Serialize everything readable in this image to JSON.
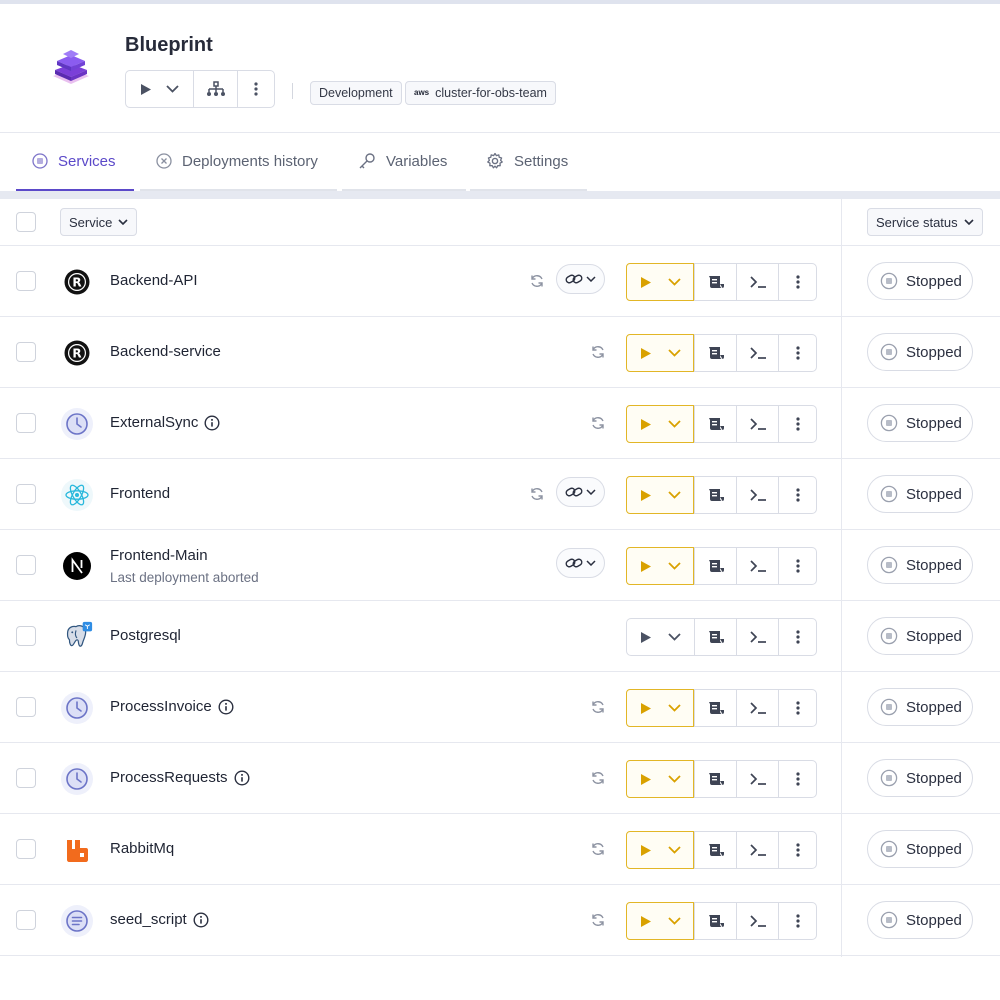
{
  "project": {
    "title": "Blueprint",
    "environment_tag": "Development",
    "cluster_provider_label": "aws",
    "cluster_tag": "cluster-for-obs-team"
  },
  "tabs": [
    {
      "label": "Services",
      "icon": "services-icon",
      "active": true
    },
    {
      "label": "Deployments history",
      "icon": "history-icon",
      "active": false
    },
    {
      "label": "Variables",
      "icon": "key-icon",
      "active": false
    },
    {
      "label": "Settings",
      "icon": "gear-icon",
      "active": false
    }
  ],
  "table": {
    "service_header": "Service",
    "status_header": "Service status"
  },
  "colors": {
    "accent": "#5b49c9",
    "play_ready": "#e2b626",
    "play_ready_icon": "#d9a100"
  },
  "services": [
    {
      "name": "Backend-API",
      "icon": "rust-icon",
      "info": false,
      "subtitle": "",
      "refresh": true,
      "link": true,
      "ready": true,
      "status": "Stopped"
    },
    {
      "name": "Backend-service",
      "icon": "rust-icon",
      "info": false,
      "subtitle": "",
      "refresh": true,
      "link": false,
      "ready": true,
      "status": "Stopped"
    },
    {
      "name": "ExternalSync",
      "icon": "clock-icon",
      "info": true,
      "subtitle": "",
      "refresh": true,
      "link": false,
      "ready": true,
      "status": "Stopped"
    },
    {
      "name": "Frontend",
      "icon": "react-icon",
      "info": false,
      "subtitle": "",
      "refresh": true,
      "link": true,
      "ready": true,
      "status": "Stopped"
    },
    {
      "name": "Frontend-Main",
      "icon": "nextjs-icon",
      "info": false,
      "subtitle": "Last deployment aborted",
      "refresh": false,
      "link": true,
      "ready": true,
      "status": "Stopped"
    },
    {
      "name": "Postgresql",
      "icon": "postgresql-icon",
      "info": false,
      "subtitle": "",
      "refresh": false,
      "link": false,
      "ready": false,
      "status": "Stopped"
    },
    {
      "name": "ProcessInvoice",
      "icon": "clock-icon",
      "info": true,
      "subtitle": "",
      "refresh": true,
      "link": false,
      "ready": true,
      "status": "Stopped"
    },
    {
      "name": "ProcessRequests",
      "icon": "clock-icon",
      "info": true,
      "subtitle": "",
      "refresh": true,
      "link": false,
      "ready": true,
      "status": "Stopped"
    },
    {
      "name": "RabbitMq",
      "icon": "rabbitmq-icon",
      "info": false,
      "subtitle": "",
      "refresh": true,
      "link": false,
      "ready": true,
      "status": "Stopped"
    },
    {
      "name": "seed_script",
      "icon": "lifecycle-job-icon",
      "info": true,
      "subtitle": "",
      "refresh": true,
      "link": false,
      "ready": true,
      "status": "Stopped"
    }
  ]
}
